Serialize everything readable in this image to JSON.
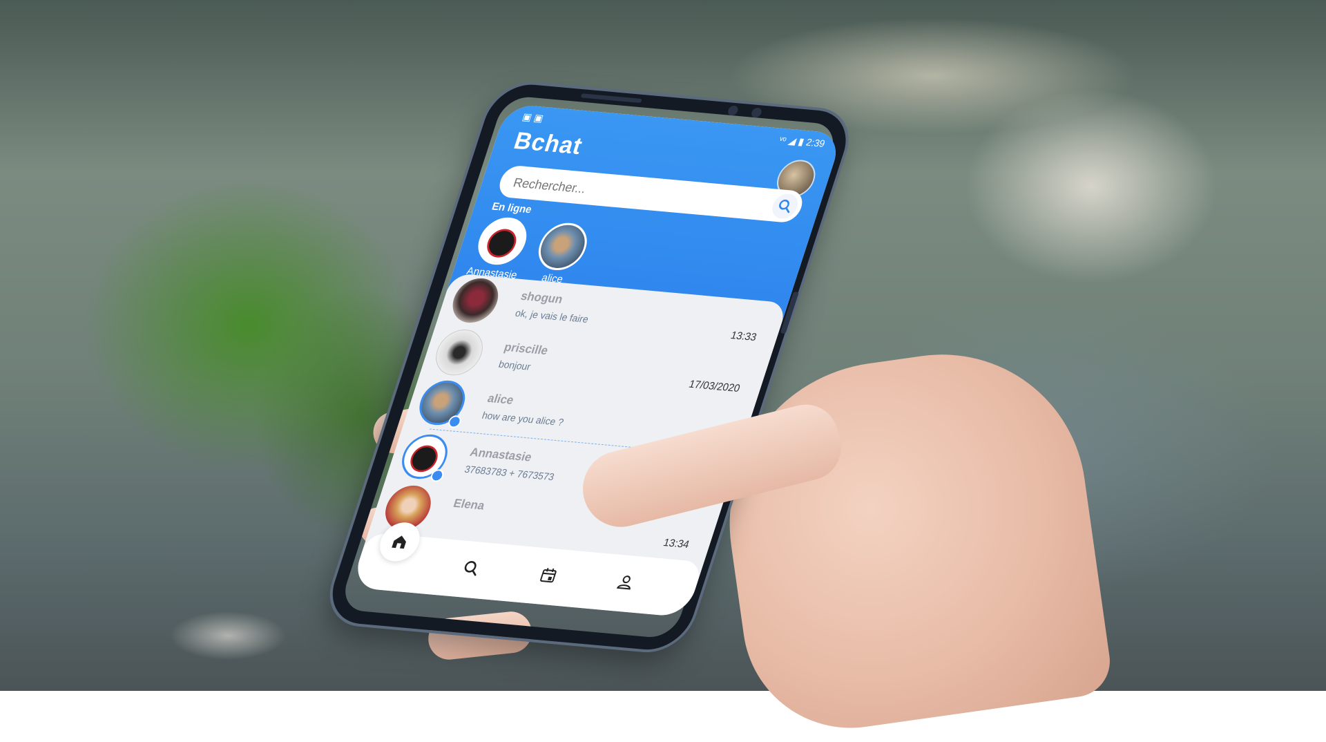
{
  "app": {
    "title": "Bchat",
    "status_time": "2:39",
    "status_left_icons": "▣ ▣",
    "status_right_icons": "ᵛᵒ ◢ ▮"
  },
  "search": {
    "placeholder": "Rechercher...",
    "icon": "search-icon"
  },
  "online": {
    "label": "En ligne",
    "users": [
      {
        "name": "Annastasie"
      },
      {
        "name": "alice"
      }
    ]
  },
  "chats": [
    {
      "name": "shogun",
      "message": "ok, je vais le faire",
      "time": "13:33",
      "online": false
    },
    {
      "name": "priscille",
      "message": "bonjour",
      "time": "17/03/2020",
      "online": false
    },
    {
      "name": "alice",
      "message": "how are you alice ?",
      "time": "",
      "online": true
    },
    {
      "name": "Annastasie",
      "message": "37683783 + 7673573",
      "time": "",
      "online": true
    },
    {
      "name": "Elena",
      "message": "",
      "time": "13:34",
      "online": false
    }
  ],
  "nav": {
    "items": [
      "home-icon",
      "search-icon",
      "calendar-icon",
      "profile-icon"
    ]
  },
  "colors": {
    "header_blue": "#3a97f2",
    "online_accent": "#3a8cf0",
    "name_gray": "#9b9ea6",
    "message_blue_gray": "#6a7c92"
  }
}
